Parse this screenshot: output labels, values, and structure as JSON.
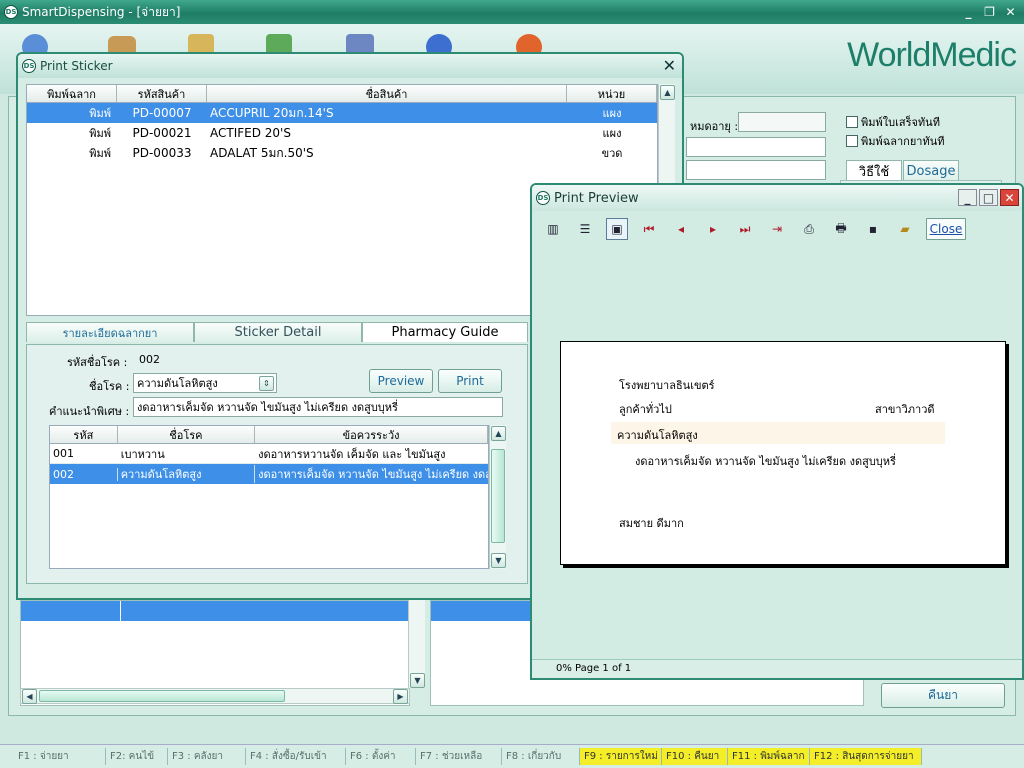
{
  "main": {
    "title": "SmartDispensing - [จ่ายยา]",
    "brand": "WorldMedic",
    "expiry_label": "หมดอายุ :",
    "print_receipt_now": "พิมพ์ใบเสร็จทันที",
    "print_label_now": "พิมพ์ฉลากยาทันที",
    "tabs": [
      "วิธีใช้",
      "Dosage"
    ],
    "return_button": "คืนยา",
    "colors": {
      "accent": "#1f7d66",
      "selection": "#3d8fe8",
      "fkey_highlight": "#f3ee27"
    }
  },
  "sticker": {
    "title": "Print Sticker",
    "columns": [
      "พิมพ์ฉลาก",
      "รหัสสินค้า",
      "ชื่อสินค้า",
      "หน่วย"
    ],
    "rows": [
      {
        "print": "พิมพ์",
        "code": "PD-00007",
        "name": "ACCUPRIL 20มก.14'S",
        "unit": "แผง"
      },
      {
        "print": "พิมพ์",
        "code": "PD-00021",
        "name": "ACTIFED 20'S",
        "unit": "แผง"
      },
      {
        "print": "พิมพ์",
        "code": "PD-00033",
        "name": "ADALAT 5มก.50'S",
        "unit": "ขวด"
      }
    ],
    "tabs": [
      "รายละเอียดฉลากยา",
      "Sticker Detail",
      "Pharmacy Guide"
    ],
    "disease_code_label": "รหัสชื่อโรค :",
    "disease_code_value": "002",
    "disease_name_label": "ชื่อโรค :",
    "disease_name_value": "ความดันโลหิตสูง",
    "advice_label": "คำแนะนำพิเศษ :",
    "advice_value": "งดอาหารเค็มจัด หวานจัด ไขมันสูง ไม่เครียด งดสูบบุหรี่",
    "preview_button": "Preview",
    "print_button": "Print",
    "guide_columns": [
      "รหัส",
      "ชื่อโรค",
      "ข้อควรระวัง"
    ],
    "guide_rows": [
      {
        "code": "001",
        "name": "เบาหวาน",
        "caution": "งดอาหารหวานจัด เค็มจัด และ ไขมันสูง"
      },
      {
        "code": "002",
        "name": "ความดันโลหิตสูง",
        "caution": "งดอาหารเค็มจัด หวานจัด ไขมันสูง ไม่เครียด งดสูบบุหรี่"
      }
    ]
  },
  "preview": {
    "title": "Print Preview",
    "close_button": "Close",
    "status": "0% Page 1 of 1",
    "doc": {
      "hospital": "โรงพยาบาลธินเขตร์",
      "customer": "ลูกค้าทั่วไป",
      "branch": "สาขาวิภาวดี",
      "disease": "ความดันโลหิตสูง",
      "advice": "งดอาหารเค็มจัด หวานจัด ไขมันสูง ไม่เครียด งดสูบบุหรี่",
      "patient": "สมชาย ดีมาก"
    }
  },
  "fkeys": [
    {
      "label": "F1 : จ่ายยา",
      "hl": false
    },
    {
      "label": "F2: คนไข้",
      "hl": false
    },
    {
      "label": "F3 : คลังยา",
      "hl": false
    },
    {
      "label": "F4 : สั่งซื้อ/รับเข้า",
      "hl": false
    },
    {
      "label": "F6 : ตั้งค่า",
      "hl": false
    },
    {
      "label": "F7 : ช่วยเหลือ",
      "hl": false
    },
    {
      "label": "F8 : เกี่ยวกับ",
      "hl": false
    },
    {
      "label": "F9 : รายการใหม่",
      "hl": true
    },
    {
      "label": "F10 : คืนยา",
      "hl": true
    },
    {
      "label": "F11 : พิมพ์ฉลาก",
      "hl": true
    },
    {
      "label": "F12 : สินสุดการจ่ายยา",
      "hl": true
    }
  ]
}
